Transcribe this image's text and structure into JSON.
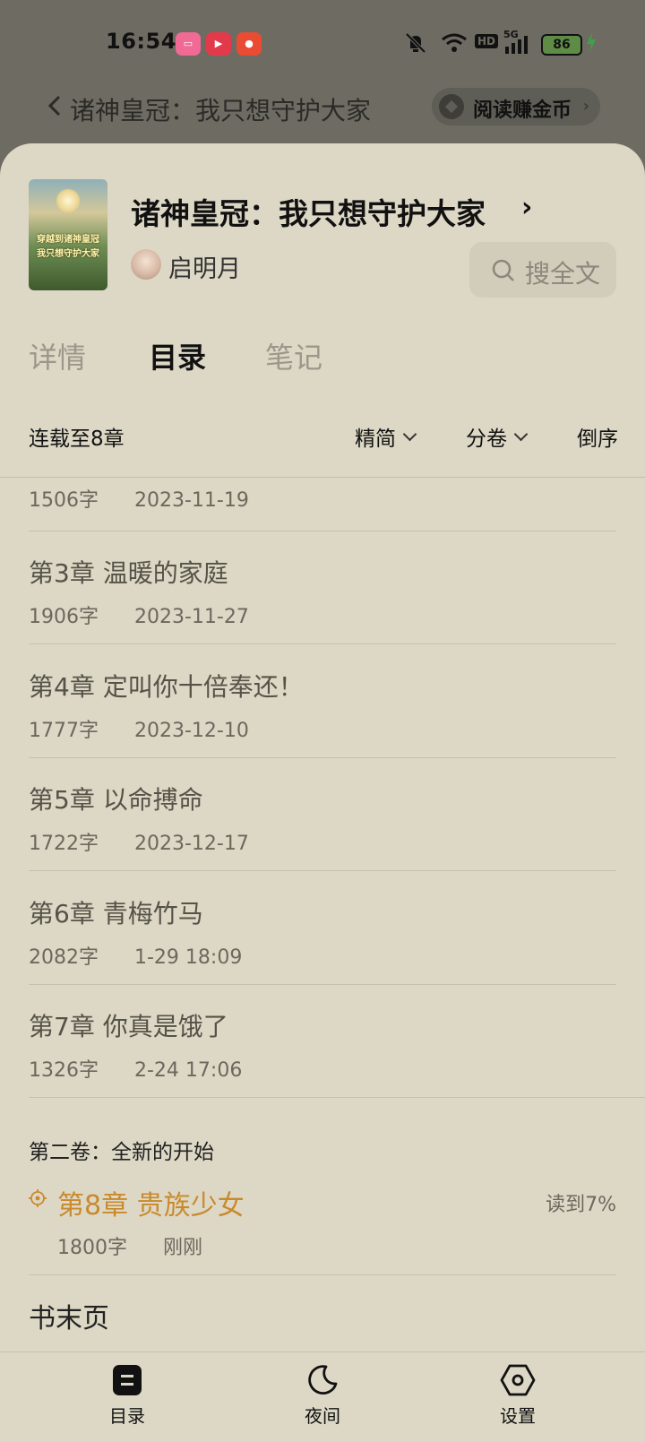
{
  "status_bar": {
    "time": "16:54",
    "battery": "86",
    "network": "5G",
    "hd": "HD",
    "app_icons": [
      "bilibili-icon",
      "video-play-icon",
      "news-icon"
    ]
  },
  "background_header": {
    "title": "诸神皇冠：我只想守护大家",
    "reward_label": "阅读赚金币"
  },
  "book": {
    "title": "诸神皇冠：我只想守护大家",
    "author": "启明月",
    "cover_line1": "穿越到诸神皇冠",
    "cover_line2": "我只想守护大家",
    "search_label": "搜全文"
  },
  "tabs": [
    {
      "label": "详情",
      "active": false
    },
    {
      "label": "目录",
      "active": true
    },
    {
      "label": "笔记",
      "active": false
    }
  ],
  "toolbar": {
    "serial_status": "连载至8章",
    "simplified": "精简",
    "volumes": "分卷",
    "reverse": "倒序"
  },
  "chapters": [
    {
      "title": "",
      "words": "1506字",
      "date": "2023-11-19"
    },
    {
      "title": "第3章 温暖的家庭",
      "words": "1906字",
      "date": "2023-11-27"
    },
    {
      "title": "第4章 定叫你十倍奉还！",
      "words": "1777字",
      "date": "2023-12-10"
    },
    {
      "title": "第5章 以命搏命",
      "words": "1722字",
      "date": "2023-12-17"
    },
    {
      "title": "第6章 青梅竹马",
      "words": "2082字",
      "date": "1-29 18:09"
    },
    {
      "title": "第7章 你真是饿了",
      "words": "1326字",
      "date": "2-24 17:06"
    }
  ],
  "volume2": {
    "title": "第二卷：全新的开始",
    "current_chapter": {
      "title": "第8章 贵族少女",
      "progress": "读到7%",
      "words": "1800字",
      "date": "刚刚"
    }
  },
  "end_page": "书末页",
  "bottom_nav": [
    {
      "label": "目录",
      "icon": "catalog-icon"
    },
    {
      "label": "夜间",
      "icon": "moon-icon"
    },
    {
      "label": "设置",
      "icon": "settings-icon"
    }
  ],
  "colors": {
    "sheet_bg": "#ddd8c5",
    "accent": "#c98a2e",
    "dim_bg": "#6d6b62"
  }
}
